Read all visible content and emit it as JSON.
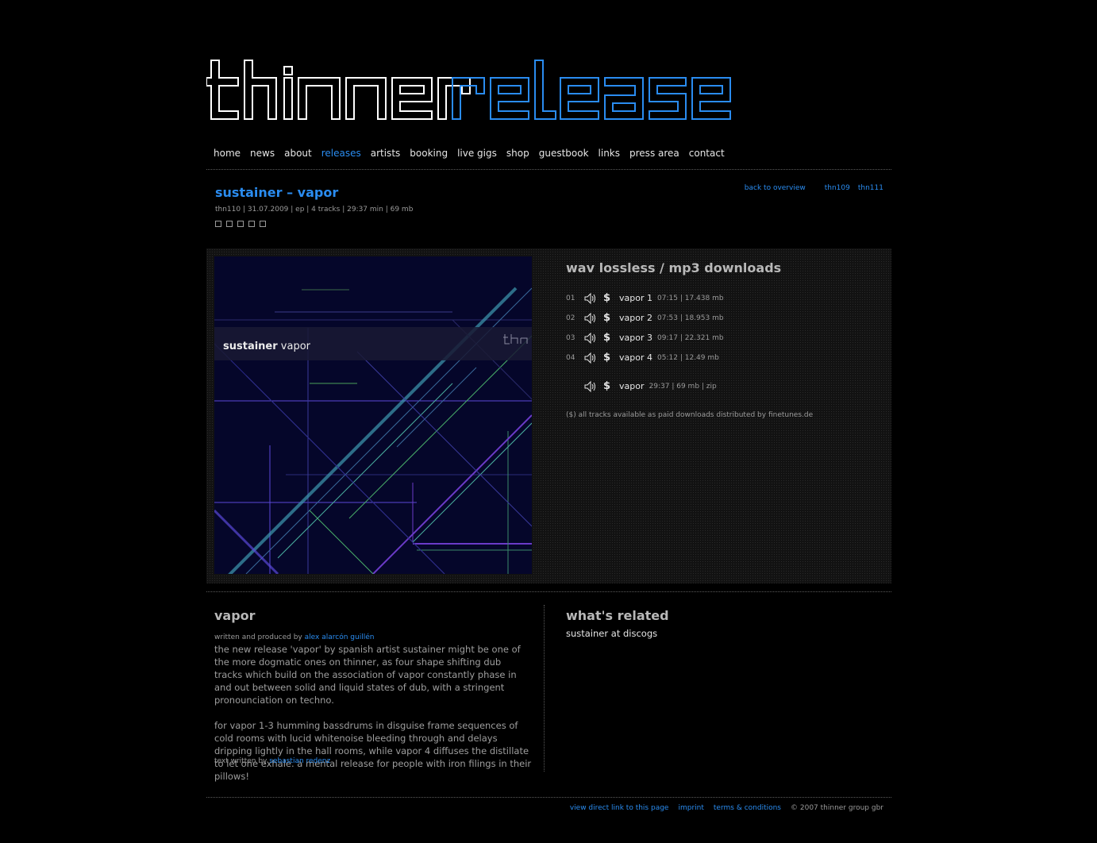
{
  "logo": {
    "word1": "thinner",
    "word2": "releases"
  },
  "nav": {
    "items": [
      "home",
      "news",
      "about",
      "releases",
      "artists",
      "booking",
      "live gigs",
      "shop",
      "guestbook",
      "links",
      "press area",
      "contact"
    ],
    "active": "releases"
  },
  "release": {
    "title": "sustainer – vapor",
    "meta": "thn110 | 31.07.2009 | ep | 4 tracks | 29:37 min | 69 mb"
  },
  "toplinks": {
    "back": "back to overview",
    "prev": "thn109",
    "next": "thn111"
  },
  "cover": {
    "artist": "sustainer",
    "title": "vapor",
    "label_mark": "thn"
  },
  "downloads": {
    "title": "wav lossless / mp3 downloads",
    "tracks": [
      {
        "num": "01",
        "name": "vapor 1",
        "info": "07:15 | 17.438 mb"
      },
      {
        "num": "02",
        "name": "vapor 2",
        "info": "07:53 | 18.953 mb"
      },
      {
        "num": "03",
        "name": "vapor 3",
        "info": "09:17 | 22.321 mb"
      },
      {
        "num": "04",
        "name": "vapor 4",
        "info": "05:12 | 12.49 mb"
      }
    ],
    "full": {
      "name": "vapor",
      "info": "29:37 | 69 mb | zip"
    },
    "dollar": "$",
    "note": "($) all tracks available as paid downloads distributed by finetunes.de"
  },
  "about": {
    "title": "vapor",
    "credit_prefix": "written and produced by",
    "credit_name": "alex alarcón guillén",
    "para1": "the new release 'vapor' by spanish artist sustainer might be one of the more dogmatic ones on thinner, as four shape shifting dub tracks which build on the association of vapor constantly phase in and out between solid and liquid states of dub, with a stringent pronounciation on techno.",
    "para2": "for vapor 1-3 humming bassdrums in disguise frame sequences of cold rooms with lucid whitenoise bleeding through and delays dripping lightly in the hall rooms, while vapor 4 diffuses the distillate to let one exhale. a mental release for people with iron filings in their pillows!",
    "text_prefix": "text written by",
    "text_name": "sebastian redenz"
  },
  "related": {
    "title": "what's related",
    "link": "sustainer at discogs"
  },
  "footer": {
    "direct": "view direct link to this page",
    "imprint": "imprint",
    "terms": "terms & conditions",
    "copyright": "© 2007 thinner group gbr"
  },
  "colors": {
    "accent": "#2a8cf0",
    "background": "#000000",
    "text": "#bdbdbd"
  }
}
